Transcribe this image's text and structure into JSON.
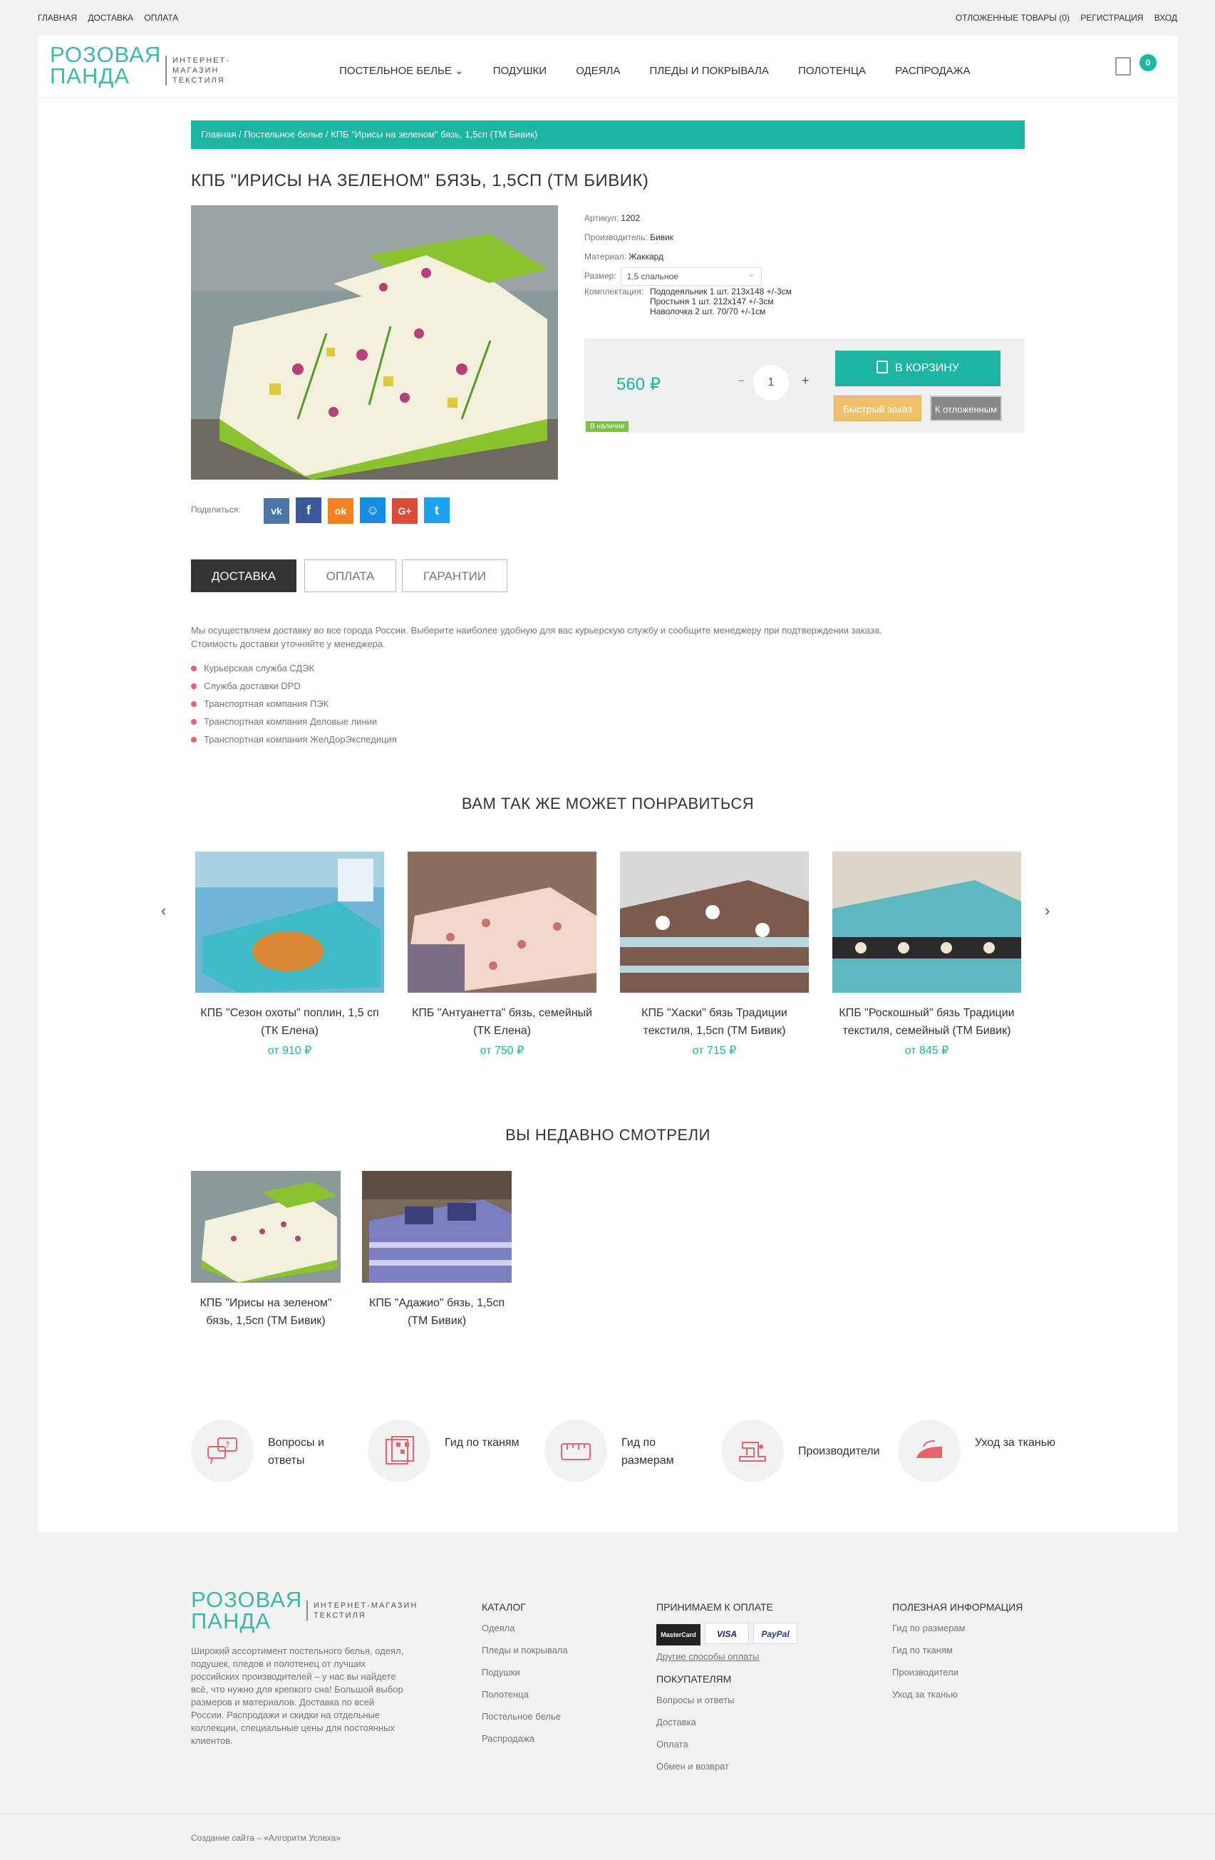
{
  "topbar": {
    "left": [
      "ГЛАВНАЯ",
      "ДОСТАВКА",
      "ОПЛАТА"
    ],
    "right": [
      "ОТЛОЖЕННЫЕ ТОВАРЫ (0)",
      "РЕГИСТРАЦИЯ",
      "ВХОД"
    ]
  },
  "header": {
    "logo_line1": "РОЗОВАЯ",
    "logo_line2": "ПАНДА",
    "logo_tag1": "ИНТЕРНЕТ-МАГАЗИН",
    "logo_tag2": "ТЕКСТИЛЯ",
    "nav": [
      "ПОСТЕЛЬНОЕ БЕЛЬЕ ⌄",
      "ПОДУШКИ",
      "ОДЕЯЛА",
      "ПЛЕДЫ И ПОКРЫВАЛА",
      "ПОЛОТЕНЦА",
      "РАСПРОДАЖА"
    ],
    "cart_count": "0"
  },
  "breadcrumb": "Главная / Постельное белье / КПБ \"Ирисы на зеленом\" бязь, 1,5сп (ТМ Бивик)",
  "product": {
    "title": "КПБ \"ИРИСЫ НА ЗЕЛЕНОМ\" БЯЗЬ, 1,5СП (ТМ БИВИК)",
    "article_label": "Артикул:",
    "article": "1202",
    "maker_label": "Производитель:",
    "maker": "Бивик",
    "material_label": "Материал:",
    "material": "Жаккард",
    "size_label": "Размер:",
    "size": "1,5 спальное",
    "set_label": "Комплектация:",
    "set_lines": [
      "Пододеяльник 1 шт. 213х148 +/-3см",
      "Простыня 1 шт. 212х147 +/-3см",
      "Наволочка 2 шт. 70/70 +/-1см"
    ],
    "price": "560 ₽",
    "qty": "1",
    "minus": "−",
    "plus": "+",
    "to_cart": "В КОРЗИНУ",
    "fast_order": "Быстрый заказ",
    "to_fav": "К отложенным",
    "stock": "В наличии"
  },
  "share": {
    "label": "Поделиться:",
    "icons": [
      {
        "name": "vk-icon",
        "glyph": "vk",
        "color": "#4a76a8"
      },
      {
        "name": "facebook-icon",
        "glyph": "f",
        "color": "#3b5998"
      },
      {
        "name": "odnoklassniki-icon",
        "glyph": "ok",
        "color": "#f58220"
      },
      {
        "name": "moimir-icon",
        "glyph": "☺",
        "color": "#168de2"
      },
      {
        "name": "googleplus-icon",
        "glyph": "G+",
        "color": "#dd4b39"
      },
      {
        "name": "twitter-icon",
        "glyph": "t",
        "color": "#1da1f2"
      }
    ]
  },
  "tabs": [
    "ДОСТАВКА",
    "ОПЛАТА",
    "ГАРАНТИИ"
  ],
  "delivery": {
    "text1": "Мы осуществляем доставку во все города России. Выберите наиболее удобную для вас курьерскую службу и сообщите менеджеру при подтверждении заказа.",
    "text2": "Стоимость доставки уточняйте у менеджера.",
    "items": [
      "Курьерская служба СДЭК",
      "Служба доставки DPD",
      "Транспортная компания ПЭК",
      "Транспортная компания Деловые линии",
      "Транспортная компания ЖелДорЭкспедиция"
    ]
  },
  "related": {
    "title": "ВАМ ТАК ЖЕ МОЖЕТ ПОНРАВИТЬСЯ",
    "prev": "‹",
    "next": "›",
    "items": [
      {
        "name": "КПБ \"Сезон охоты\" поплин, 1,5 сп (ТК Елена)",
        "price": "от 910 ₽"
      },
      {
        "name": "КПБ \"Антуанетта\" бязь, семейный (ТК Елена)",
        "price": "от 750 ₽"
      },
      {
        "name": "КПБ \"Хаски\" бязь Традиции текстиля, 1,5сп (ТМ Бивик)",
        "price": "от 715 ₽"
      },
      {
        "name": "КПБ \"Роскошный\" бязь Традиции текстиля, семейный (ТМ Бивик)",
        "price": "от 845 ₽"
      }
    ]
  },
  "recent": {
    "title": "ВЫ НЕДАВНО СМОТРЕЛИ",
    "items": [
      {
        "name": "КПБ \"Ирисы на зеленом\" бязь, 1,5сп (ТМ Бивик)"
      },
      {
        "name": "КПБ \"Адажио\" бязь, 1,5сп (ТМ Бивик)"
      }
    ]
  },
  "info": [
    {
      "label": "Вопросы и ответы"
    },
    {
      "label": "Гид по тканям"
    },
    {
      "label": "Гид по размерам"
    },
    {
      "label": "Производители"
    },
    {
      "label": "Уход за тканью"
    }
  ],
  "footer": {
    "about": "Широкий ассортимент постельного белья, одеял, подушек, пледов и полотенец от лучших российских производителей – у нас вы найдете всё, что нужно для крепкого сна! Большой выбор размеров и материалов. Доставка по всей России. Распродажи и скидки на отдельные коллекции, специальные цены для постоянных клиентов.",
    "catalog_title": "КАТАЛОГ",
    "catalog": [
      "Одеяла",
      "Пледы и покрывала",
      "Подушки",
      "Полотенца",
      "Постельное белье",
      "Распродажа"
    ],
    "pay_title": "ПРИНИМАЕМ К ОПЛАТЕ",
    "pay_cards": [
      "MasterCard",
      "VISA",
      "PayPal"
    ],
    "pay_other": "Другие способы оплаты",
    "buyers_title": "ПОКУПАТЕЛЯМ",
    "buyers": [
      "Вопросы и ответы",
      "Доставка",
      "Оплата",
      "Обмен и возврат"
    ],
    "useful_title": "ПОЛЕЗНАЯ ИНФОРМАЦИЯ",
    "useful": [
      "Гид по размерам",
      "Гид по тканям",
      "Производители",
      "Уход за тканью"
    ],
    "copyright": "Создание сайта – «Алгоритм Успеха»"
  },
  "colors": {
    "accent": "#1bb5a2",
    "brand": "#3cb9a5",
    "bullet": "#e8636b",
    "icons": "#e8636b"
  }
}
